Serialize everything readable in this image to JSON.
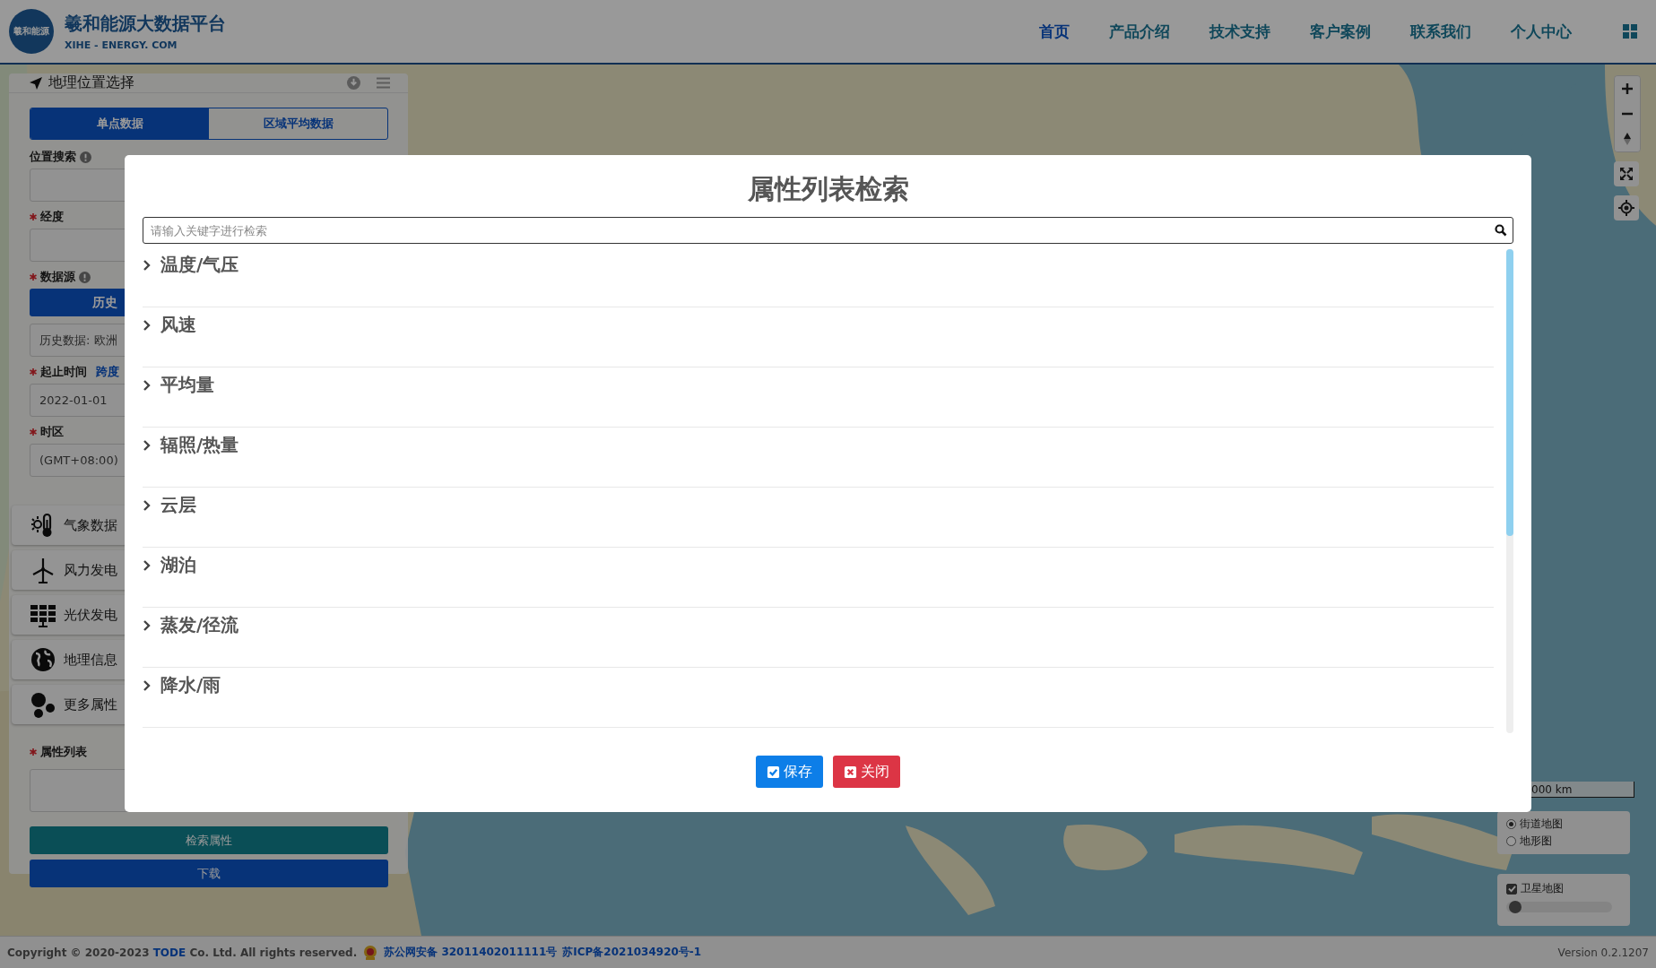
{
  "header": {
    "logo_text": "羲和能源",
    "title": "羲和能源大数据平台",
    "subtitle": "XIHE - ENERGY. COM",
    "nav": [
      {
        "label": "首页",
        "selected": true
      },
      {
        "label": "产品介绍",
        "selected": false
      },
      {
        "label": "技术支持",
        "selected": false
      },
      {
        "label": "客户案例",
        "selected": false
      },
      {
        "label": "联系我们",
        "selected": false
      },
      {
        "label": "个人中心",
        "selected": false
      }
    ]
  },
  "map": {
    "kind": "picture",
    "scale_label": "000 km",
    "layers": [
      {
        "label": "街道地图",
        "selected": true
      },
      {
        "label": "地形图",
        "selected": false
      }
    ],
    "satellite": {
      "label": "卫星地图",
      "checked": true,
      "level": 0.03
    }
  },
  "side_panel": {
    "title": "地理位置选择",
    "tabs": [
      {
        "label": "单点数据",
        "selected": true
      },
      {
        "label": "区域平均数据",
        "selected": false
      }
    ],
    "form": [
      {
        "kind": "label",
        "text": "位置搜索",
        "required": false,
        "info": true
      },
      {
        "kind": "input"
      },
      {
        "kind": "label",
        "text": "经度",
        "required": true,
        "info": false
      },
      {
        "kind": "input"
      },
      {
        "kind": "label",
        "text": "数据源",
        "required": true,
        "info": true
      },
      {
        "kind": "button",
        "text": "历史"
      },
      {
        "kind": "input",
        "value": "历史数据: 欧洲"
      },
      {
        "kind": "label",
        "text": "起止时间",
        "required": true,
        "info": false,
        "link": "跨度"
      },
      {
        "kind": "input",
        "value": "2022-01-01"
      },
      {
        "kind": "label",
        "text": "时区",
        "required": true,
        "info": false
      },
      {
        "kind": "input",
        "value": "(GMT+08:00)"
      }
    ],
    "sections": [
      {
        "label": "气象数据"
      },
      {
        "label": "风力发电"
      },
      {
        "label": "光伏发电"
      },
      {
        "label": "地理信息"
      },
      {
        "label": "更多属性"
      }
    ],
    "attribute_label": {
      "text": "属性列表",
      "required": true
    },
    "buttons": [
      {
        "label": "检索属性",
        "kind": "search"
      },
      {
        "label": "下载",
        "kind": "download"
      }
    ]
  },
  "modal": {
    "title": "属性列表检索",
    "search": {
      "placeholder": "请输入关键字进行检索"
    },
    "groups": [
      {
        "label": "温度/气压",
        "expanded": false
      },
      {
        "label": "风速",
        "expanded": false
      },
      {
        "label": "平均量",
        "expanded": false
      },
      {
        "label": "辐照/热量",
        "expanded": false
      },
      {
        "label": "云层",
        "expanded": false
      },
      {
        "label": "湖泊",
        "expanded": false
      },
      {
        "label": "蒸发/径流",
        "expanded": false
      },
      {
        "label": "降水/雨",
        "expanded": false
      }
    ],
    "buttons": [
      {
        "label": "保存",
        "kind": "save"
      },
      {
        "label": "关闭",
        "kind": "close"
      }
    ]
  },
  "footer": {
    "copyright": "Copyright © 2020-2023",
    "company": "TODE",
    "rights": "Co. Ltd. All rights reserved.",
    "police_record": "苏公网安备 32011402011111号",
    "icp_record": "苏ICP备2021034920号-1",
    "version": "Version 0.2.1207"
  }
}
